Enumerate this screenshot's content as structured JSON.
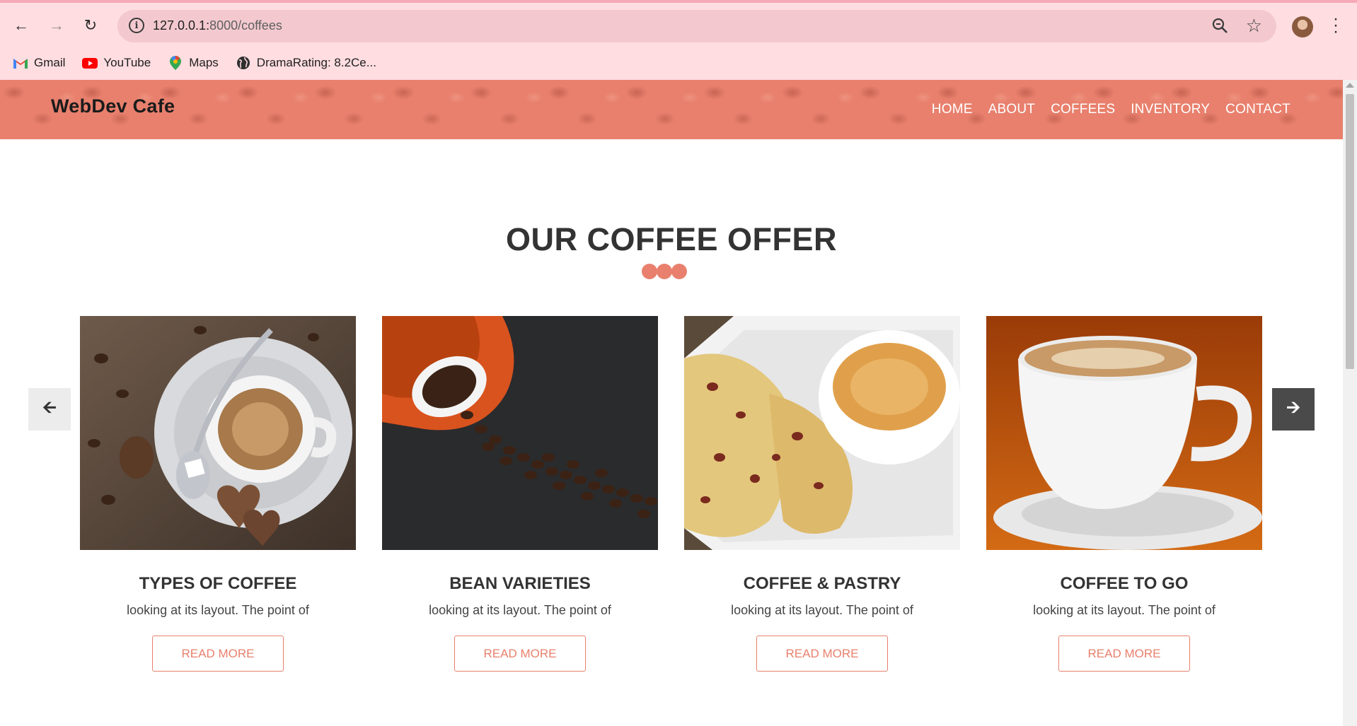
{
  "browser": {
    "url_host": "127.0.0.1:",
    "url_path": "8000/coffees",
    "bookmarks": [
      {
        "label": "Gmail",
        "icon": "gmail-icon"
      },
      {
        "label": "YouTube",
        "icon": "youtube-icon"
      },
      {
        "label": "Maps",
        "icon": "maps-icon"
      },
      {
        "label": "DramaRating: 8.2Ce...",
        "icon": "globe-icon"
      }
    ]
  },
  "site": {
    "logo": "WebDev Cafe",
    "nav": [
      "HOME",
      "ABOUT",
      "COFFEES",
      "INVENTORY",
      "CONTACT"
    ],
    "accent_color": "#e8806d"
  },
  "section": {
    "title": "OUR COFFEE OFFER"
  },
  "cards": [
    {
      "title": "TYPES OF COFFEE",
      "text": "looking at its layout. The point of",
      "button": "READ MORE",
      "image": "espresso-with-chocolates"
    },
    {
      "title": "BEAN VARIETIES",
      "text": "looking at its layout. The point of",
      "button": "READ MORE",
      "image": "spilled-coffee-beans"
    },
    {
      "title": "COFFEE & PASTRY",
      "text": "looking at its layout. The point of",
      "button": "READ MORE",
      "image": "coffee-with-fruit-bread"
    },
    {
      "title": "COFFEE TO GO",
      "text": "looking at its layout. The point of",
      "button": "READ MORE",
      "image": "cappuccino-cup"
    }
  ],
  "slider": {
    "prev_icon": "arrow-left-icon",
    "next_icon": "arrow-right-icon"
  }
}
